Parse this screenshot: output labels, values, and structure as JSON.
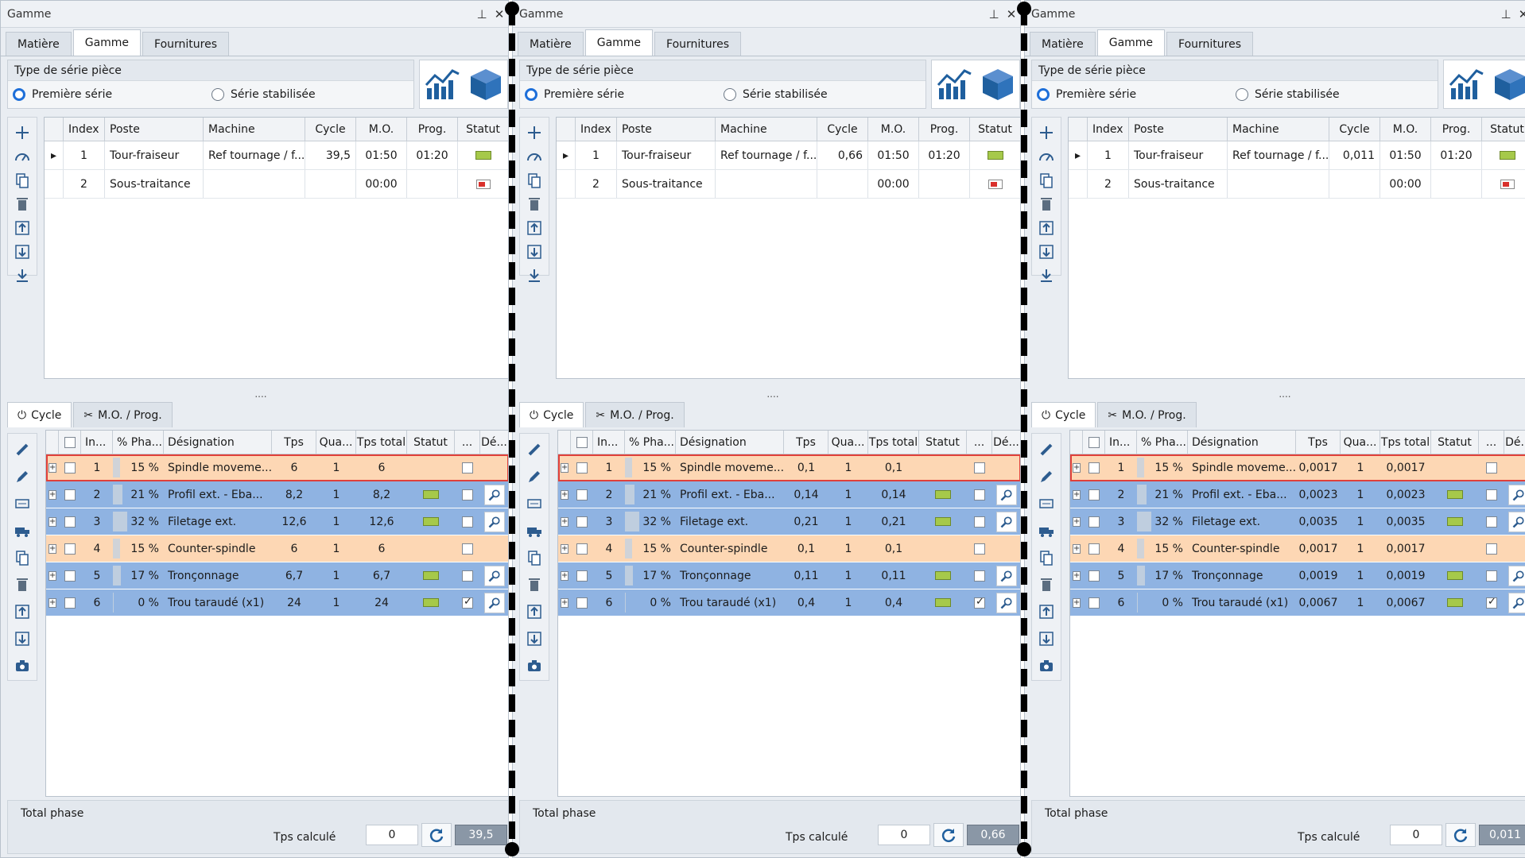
{
  "panel_title": "Gamme",
  "tabs": [
    "Matière",
    "Gamme",
    "Fournitures"
  ],
  "serie": {
    "title": "Type de série pièce",
    "option1": "Première série",
    "option2": "Série stabilisée"
  },
  "route_headers": [
    "Index",
    "Poste",
    "Machine",
    "Cycle",
    "M.O.",
    "Prog.",
    "Statut"
  ],
  "bottom_tabs": [
    "Cycle",
    "M.O. / Prog."
  ],
  "phase_headers": [
    "In...",
    "% Pha...",
    "Désignation",
    "Tps",
    "Qua...",
    "Tps total",
    "Statut",
    "...",
    "Dé..."
  ],
  "footer": {
    "title": "Total phase",
    "tps_label": "Tps calculé"
  },
  "splitter": "....",
  "colors": {
    "selected_radio": "#1e6fd9",
    "orange_row": "#fdd7b4",
    "blue_row": "#8fb3e2",
    "selected_border": "#e0403a"
  },
  "panels": [
    {
      "routes": [
        {
          "index": "1",
          "poste": "Tour-fraiseur",
          "machine": "Ref tournage / f...",
          "cycle": "39,5",
          "mo": "01:50",
          "prog": "01:20",
          "statut": "ok"
        },
        {
          "index": "2",
          "poste": "Sous-traitance",
          "machine": "",
          "cycle": "",
          "mo": "00:00",
          "prog": "",
          "statut": "red"
        }
      ],
      "phases": [
        {
          "index": "1",
          "pct": "15 %",
          "pct_value": 15,
          "designation": "Spindle moveme...",
          "tps": "6",
          "qua": "1",
          "tps_total": "6",
          "color": "orange",
          "status": false,
          "checked": false,
          "detail": false,
          "selected": true
        },
        {
          "index": "2",
          "pct": "21 %",
          "pct_value": 21,
          "designation": "Profil ext. - Eba...",
          "tps": "8,2",
          "qua": "1",
          "tps_total": "8,2",
          "color": "blue",
          "status": true,
          "checked": false,
          "detail": true,
          "selected": false
        },
        {
          "index": "3",
          "pct": "32 %",
          "pct_value": 32,
          "designation": "Filetage ext.",
          "tps": "12,6",
          "qua": "1",
          "tps_total": "12,6",
          "color": "blue",
          "status": true,
          "checked": false,
          "detail": true,
          "selected": false
        },
        {
          "index": "4",
          "pct": "15 %",
          "pct_value": 15,
          "designation": "Counter-spindle",
          "tps": "6",
          "qua": "1",
          "tps_total": "6",
          "color": "orange",
          "status": false,
          "checked": false,
          "detail": false,
          "selected": false
        },
        {
          "index": "5",
          "pct": "17 %",
          "pct_value": 17,
          "designation": "Tronçonnage",
          "tps": "6,7",
          "qua": "1",
          "tps_total": "6,7",
          "color": "blue",
          "status": true,
          "checked": false,
          "detail": true,
          "selected": false
        },
        {
          "index": "6",
          "pct": "0 %",
          "pct_value": 0,
          "designation": "Trou taraudé (x1)",
          "tps": "24",
          "qua": "1",
          "tps_total": "24",
          "color": "blue",
          "status": true,
          "checked": true,
          "detail": true,
          "selected": false
        }
      ],
      "footer_input": "0",
      "footer_result": "39,5"
    },
    {
      "routes": [
        {
          "index": "1",
          "poste": "Tour-fraiseur",
          "machine": "Ref tournage / f...",
          "cycle": "0,66",
          "mo": "01:50",
          "prog": "01:20",
          "statut": "ok"
        },
        {
          "index": "2",
          "poste": "Sous-traitance",
          "machine": "",
          "cycle": "",
          "mo": "00:00",
          "prog": "",
          "statut": "red"
        }
      ],
      "phases": [
        {
          "index": "1",
          "pct": "15 %",
          "pct_value": 15,
          "designation": "Spindle moveme...",
          "tps": "0,1",
          "qua": "1",
          "tps_total": "0,1",
          "color": "orange",
          "status": false,
          "checked": false,
          "detail": false,
          "selected": true
        },
        {
          "index": "2",
          "pct": "21 %",
          "pct_value": 21,
          "designation": "Profil ext. - Eba...",
          "tps": "0,14",
          "qua": "1",
          "tps_total": "0,14",
          "color": "blue",
          "status": true,
          "checked": false,
          "detail": true,
          "selected": false
        },
        {
          "index": "3",
          "pct": "32 %",
          "pct_value": 32,
          "designation": "Filetage ext.",
          "tps": "0,21",
          "qua": "1",
          "tps_total": "0,21",
          "color": "blue",
          "status": true,
          "checked": false,
          "detail": true,
          "selected": false
        },
        {
          "index": "4",
          "pct": "15 %",
          "pct_value": 15,
          "designation": "Counter-spindle",
          "tps": "0,1",
          "qua": "1",
          "tps_total": "0,1",
          "color": "orange",
          "status": false,
          "checked": false,
          "detail": false,
          "selected": false
        },
        {
          "index": "5",
          "pct": "17 %",
          "pct_value": 17,
          "designation": "Tronçonnage",
          "tps": "0,11",
          "qua": "1",
          "tps_total": "0,11",
          "color": "blue",
          "status": true,
          "checked": false,
          "detail": true,
          "selected": false
        },
        {
          "index": "6",
          "pct": "0 %",
          "pct_value": 0,
          "designation": "Trou taraudé (x1)",
          "tps": "0,4",
          "qua": "1",
          "tps_total": "0,4",
          "color": "blue",
          "status": true,
          "checked": true,
          "detail": true,
          "selected": false
        }
      ],
      "footer_input": "0",
      "footer_result": "0,66"
    },
    {
      "routes": [
        {
          "index": "1",
          "poste": "Tour-fraiseur",
          "machine": "Ref tournage / f...",
          "cycle": "0,011",
          "mo": "01:50",
          "prog": "01:20",
          "statut": "ok"
        },
        {
          "index": "2",
          "poste": "Sous-traitance",
          "machine": "",
          "cycle": "",
          "mo": "00:00",
          "prog": "",
          "statut": "red"
        }
      ],
      "phases": [
        {
          "index": "1",
          "pct": "15 %",
          "pct_value": 15,
          "designation": "Spindle moveme...",
          "tps": "0,0017",
          "qua": "1",
          "tps_total": "0,0017",
          "color": "orange",
          "status": false,
          "checked": false,
          "detail": false,
          "selected": true
        },
        {
          "index": "2",
          "pct": "21 %",
          "pct_value": 21,
          "designation": "Profil ext. - Eba...",
          "tps": "0,0023",
          "qua": "1",
          "tps_total": "0,0023",
          "color": "blue",
          "status": true,
          "checked": false,
          "detail": true,
          "selected": false
        },
        {
          "index": "3",
          "pct": "32 %",
          "pct_value": 32,
          "designation": "Filetage ext.",
          "tps": "0,0035",
          "qua": "1",
          "tps_total": "0,0035",
          "color": "blue",
          "status": true,
          "checked": false,
          "detail": true,
          "selected": false
        },
        {
          "index": "4",
          "pct": "15 %",
          "pct_value": 15,
          "designation": "Counter-spindle",
          "tps": "0,0017",
          "qua": "1",
          "tps_total": "0,0017",
          "color": "orange",
          "status": false,
          "checked": false,
          "detail": false,
          "selected": false
        },
        {
          "index": "5",
          "pct": "17 %",
          "pct_value": 17,
          "designation": "Tronçonnage",
          "tps": "0,0019",
          "qua": "1",
          "tps_total": "0,0019",
          "color": "blue",
          "status": true,
          "checked": false,
          "detail": true,
          "selected": false
        },
        {
          "index": "6",
          "pct": "0 %",
          "pct_value": 0,
          "designation": "Trou taraudé (x1)",
          "tps": "0,0067",
          "qua": "1",
          "tps_total": "0,0067",
          "color": "blue",
          "status": true,
          "checked": true,
          "detail": true,
          "selected": false
        }
      ],
      "footer_input": "0",
      "footer_result": "0,011"
    }
  ]
}
